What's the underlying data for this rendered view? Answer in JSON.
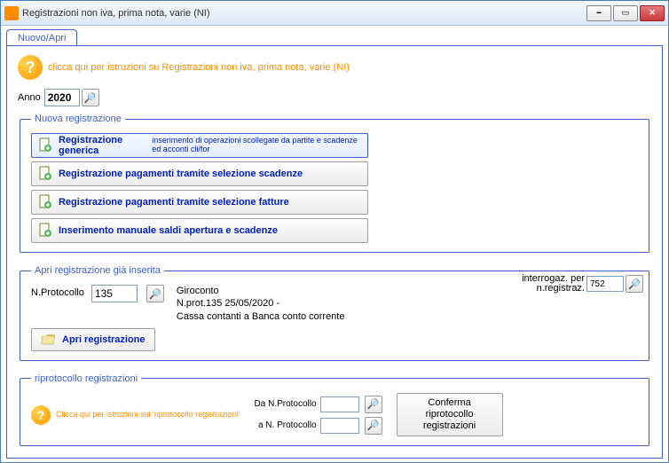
{
  "window": {
    "title": "Registrazioni non iva, prima nota, varie (NI)"
  },
  "tab": {
    "label": "Nuovo/Apri"
  },
  "help_main": "clicca qui per istruzioni su Registrazioni non iva, prima nota, varie (NI)",
  "anno": {
    "label": "Anno",
    "value": "2020"
  },
  "nuova_reg": {
    "legend": "Nuova registrazione",
    "buttons": [
      {
        "label": "Registrazione generica",
        "desc": "inserimento di operazioni scollegate da partite e scadenze ed acconti cli/for"
      },
      {
        "label": "Registrazione pagamenti tramite selezione scadenze",
        "desc": ""
      },
      {
        "label": "Registrazione pagamenti tramite selezione fatture",
        "desc": ""
      },
      {
        "label": "Inserimento manuale saldi apertura e scadenze",
        "desc": ""
      }
    ]
  },
  "apri_reg": {
    "legend": "Apri registrazione già inserita",
    "nprot_label": "N.Protocollo",
    "nprot_value": "135",
    "details_line1": "Giroconto",
    "details_line2": "N.prot.135 25/05/2020 -",
    "details_line3": "Cassa contanti a Banca conto corrente",
    "open_button": "Apri registrazione",
    "interrog_label": "interrogaz. per n.registraz.",
    "interrog_value": "752"
  },
  "riproto": {
    "legend": "riprotocollo registrazioni",
    "help_text": "Clicca qui per istruzioni sul 'riprotocollo registrazioni'",
    "da_label": "Da N.Protocollo",
    "a_label": "a N. Protocollo",
    "da_value": "",
    "a_value": "",
    "confirm_button": "Conferma riprotocollo registrazioni"
  }
}
